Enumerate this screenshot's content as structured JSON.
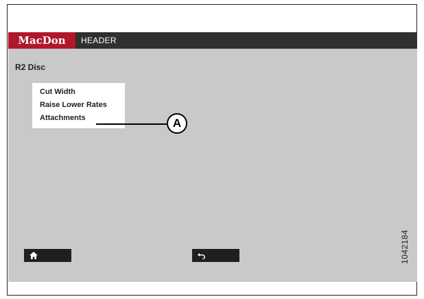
{
  "header": {
    "logo_text": "MacDon",
    "label": "HEADER",
    "brand_color": "#b0182a"
  },
  "screen": {
    "title": "R2 Disc",
    "menu_items": [
      "Cut Width",
      "Raise Lower Rates",
      "Attachments"
    ]
  },
  "callout": {
    "label": "A"
  },
  "buttons": {
    "home_icon": "home-icon",
    "back_icon": "back-arrow-icon"
  },
  "figure_number": "1042184"
}
